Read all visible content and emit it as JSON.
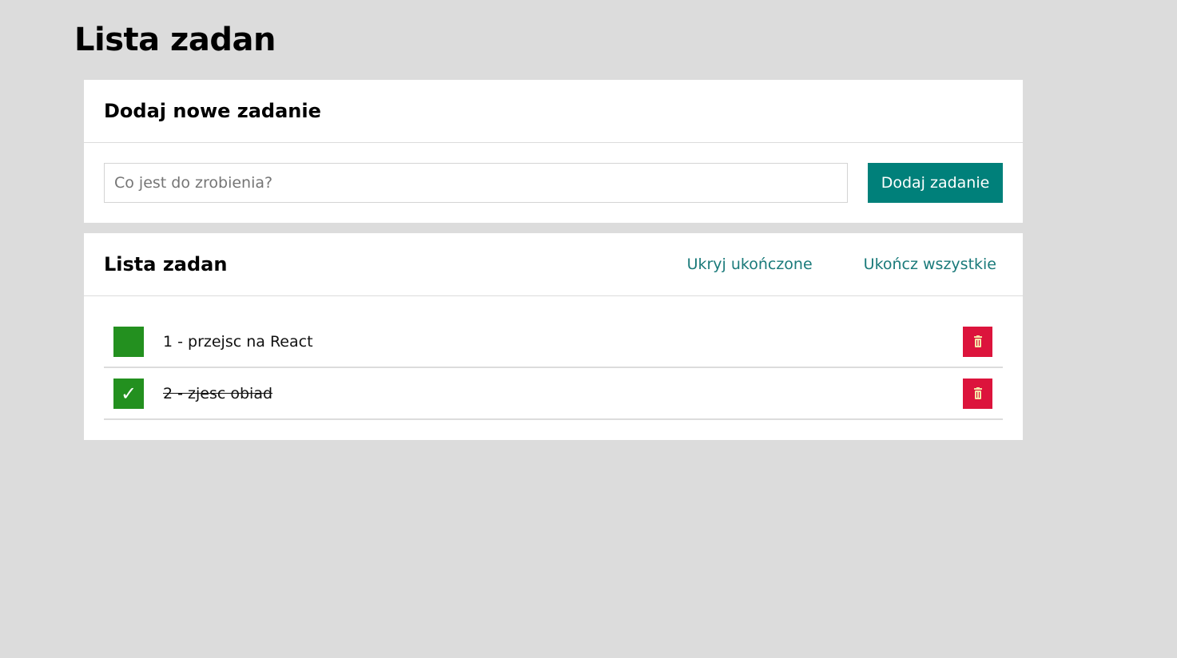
{
  "page": {
    "title": "Lista zadan"
  },
  "add_card": {
    "title": "Dodaj nowe zadanie",
    "input_placeholder": "Co jest do zrobienia?",
    "input_value": "",
    "button_label": "Dodaj zadanie"
  },
  "list_card": {
    "title": "Lista zadan",
    "hide_completed_label": "Ukryj ukończone",
    "complete_all_label": "Ukończ wszystkie",
    "tasks": [
      {
        "text": "1 - przejsc na React",
        "done": false,
        "check_glyph": ""
      },
      {
        "text": "2 - zjesc obiad",
        "done": true,
        "check_glyph": "✓"
      }
    ]
  },
  "icons": {
    "checkbox": "checkmark-icon",
    "delete": "trash-icon"
  },
  "colors": {
    "accent": "#00807a",
    "link": "#1a7a7a",
    "checkbox": "#23901f",
    "delete": "#dc143c",
    "background": "#dcdcdc"
  }
}
